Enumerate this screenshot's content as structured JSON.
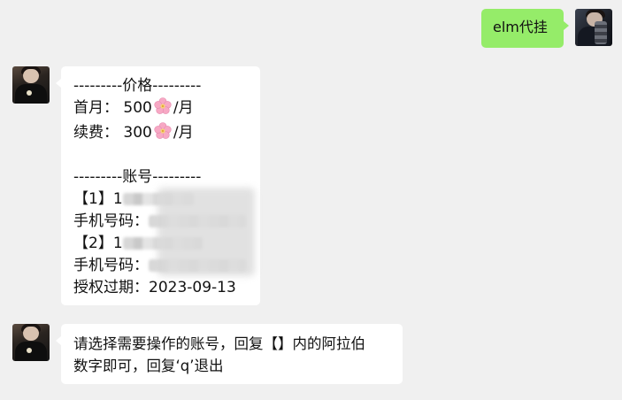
{
  "messages": {
    "outgoing": {
      "text": "elm代挂"
    },
    "price_card": {
      "price_header": "---------价格---------",
      "first_month_label": "首月：",
      "first_month_price": "500",
      "first_month_unit": "/月",
      "renew_label": "续费：",
      "renew_price": "300",
      "renew_unit": "/月",
      "account_header": "---------账号---------",
      "account1_index": "【1】1",
      "phone_label_1": "手机号码：",
      "account2_index": "【2】1",
      "phone_label_2": "手机号码：",
      "expiry_label": "授权过期：",
      "expiry_date": "2023-09-13"
    },
    "instruction": {
      "line1": "请选择需要操作的账号，回复【】内的阿拉伯",
      "line2": "数字即可，回复‘q’退出"
    }
  },
  "colors": {
    "background": "#f0f0f0",
    "self_bubble": "#95ec69",
    "other_bubble": "#ffffff"
  },
  "icons": {
    "flower": "cherry-blossom-emoji"
  }
}
